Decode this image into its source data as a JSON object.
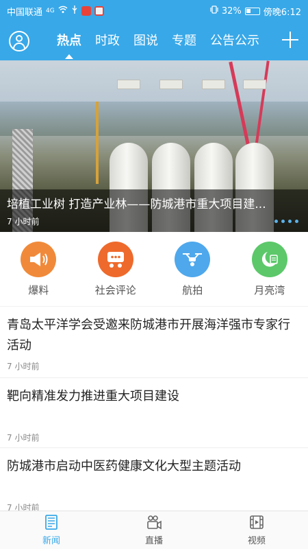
{
  "status_bar": {
    "carrier": "中国联通",
    "network": "4G",
    "battery": "32%",
    "time": "傍晚6:12"
  },
  "top_nav": {
    "tabs": [
      "热点",
      "时政",
      "图说",
      "专题",
      "公告公示"
    ],
    "active_tab": "热点"
  },
  "banner": {
    "title": "培植工业树 打造产业林——防城港市重大项目建...",
    "time": "7 小时前",
    "dots": 4
  },
  "quick_links": [
    {
      "label": "爆料",
      "icon": "megaphone-icon",
      "color": "#f08a3a"
    },
    {
      "label": "社会评论",
      "icon": "chat-icon",
      "color": "#ee6a2c"
    },
    {
      "label": "航拍",
      "icon": "drone-icon",
      "color": "#4fa8ec"
    },
    {
      "label": "月亮湾",
      "icon": "moon-icon",
      "color": "#5cc86a"
    }
  ],
  "news": [
    {
      "title": "青岛太平洋学会受邀来防城港市开展海洋强市专家行活动",
      "time": "7 小时前"
    },
    {
      "title": "靶向精准发力推进重大项目建设",
      "time": "7 小时前"
    },
    {
      "title": "防城港市启动中医药健康文化大型主题活动",
      "time": "7 小时前"
    }
  ],
  "bottom_bar": {
    "items": [
      {
        "label": "新闻",
        "icon": "newspaper-icon"
      },
      {
        "label": "直播",
        "icon": "live-camera-icon"
      },
      {
        "label": "视频",
        "icon": "film-icon"
      }
    ],
    "active": "新闻",
    "accent_color": "#38a8e8"
  }
}
